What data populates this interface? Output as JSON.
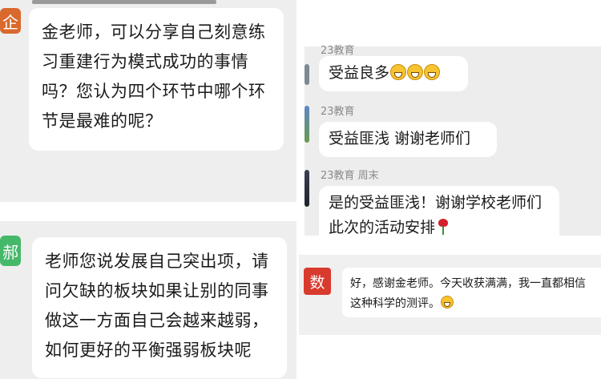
{
  "messages": {
    "teacher_question": {
      "avatar": "企",
      "text": "金老师，可以分享自己刻意练习重建行为模式成功的事情吗？您认为四个环节中哪个环节是最难的呢？"
    },
    "colleague_question": {
      "avatar": "郝",
      "text": "老师您说发展自己突出项，请问欠缺的板块如果让别的同事做这一方面自己会越来越弱，如何更好的平衡强弱板块呢"
    },
    "group_chat": [
      {
        "sender": "23教育",
        "text": "受益良多",
        "emoji_count": 3
      },
      {
        "sender": "23教育",
        "text": "受益匪浅  谢谢老师们"
      },
      {
        "sender": "23教育 周末",
        "text": "是的受益匪浅！谢谢学校老师们此次的活动安排"
      }
    ],
    "feedback": {
      "avatar": "数",
      "text": "好，感谢金老师。今天收获满满，我一直都相信这种科学的测评。"
    }
  },
  "icons": {
    "grin": "grinning-face-emoji",
    "rose": "rose-emoji"
  },
  "colors": {
    "avatar_orange": "#d9692c",
    "avatar_green": "#46b86a",
    "avatar_red": "#d83a2e",
    "panel_bg": "#eeeeee",
    "bubble_bg": "#ffffff"
  }
}
